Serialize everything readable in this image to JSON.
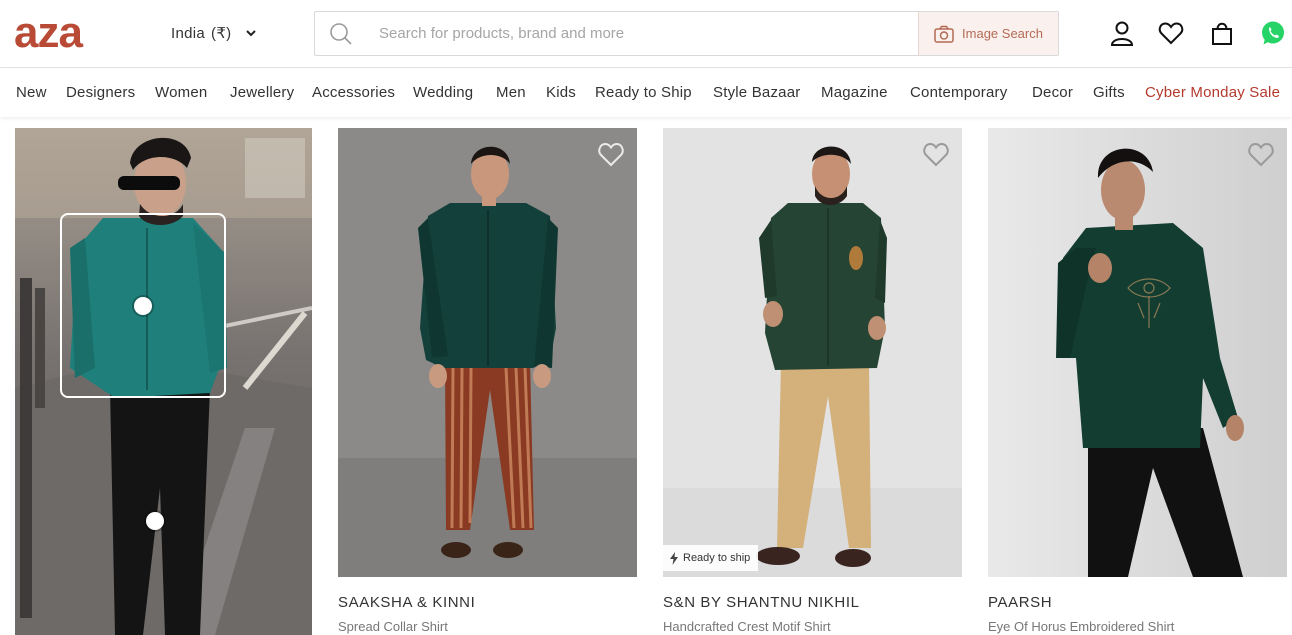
{
  "header": {
    "logo_text": "aza",
    "region_label": "India",
    "currency": "(₹)",
    "search_placeholder": "Search for products, brand and more",
    "image_search_label": "Image Search",
    "icons": [
      "user-icon",
      "heart-icon",
      "bag-icon",
      "whatsapp-icon"
    ]
  },
  "nav": {
    "items": [
      "New",
      "Designers",
      "Women",
      "Jewellery",
      "Accessories",
      "Wedding",
      "Men",
      "Kids",
      "Ready to Ship",
      "Style Bazaar",
      "Magazine",
      "Contemporary",
      "Decor",
      "Gifts",
      "Cyber Monday Sale"
    ]
  },
  "colors": {
    "brand": "#b84a36",
    "sale": "#b43a2e",
    "image_search_bg": "#faf1ee"
  },
  "products": [
    {
      "brand": "SAAKSHA & KINNI",
      "name": "Spread Collar Shirt",
      "badge": ""
    },
    {
      "brand": "S&N BY SHANTNU NIKHIL",
      "name": "Handcrafted Crest Motif Shirt",
      "badge": "Ready to ship"
    },
    {
      "brand": "PAARSH",
      "name": "Eye Of Horus Embroidered Shirt",
      "badge": ""
    }
  ]
}
